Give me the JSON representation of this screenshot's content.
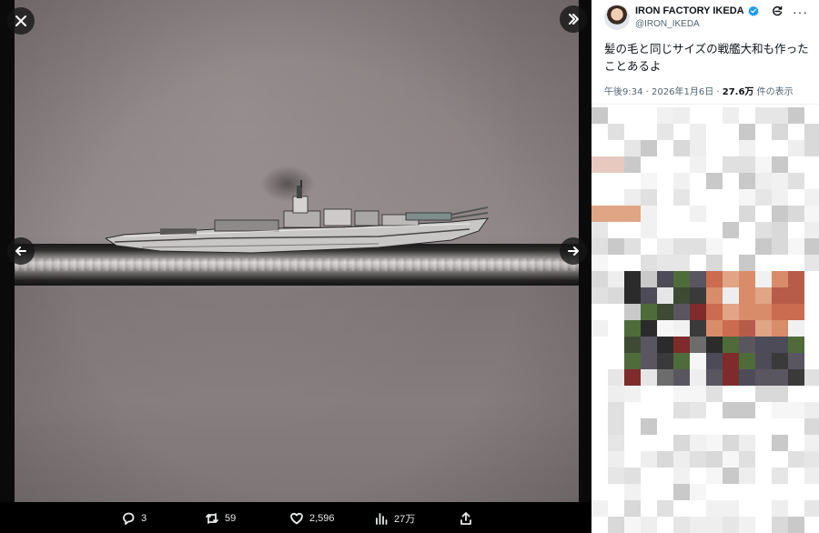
{
  "viewer": {
    "close_label": "close",
    "prev_label": "previous",
    "next_label": "next",
    "expand_label": "expand"
  },
  "actions": {
    "reply_count": "3",
    "retweet_count": "59",
    "like_count": "2,596",
    "view_count": "27万"
  },
  "tweet": {
    "display_name": "IRON FACTORY IKEDA",
    "handle": "@IRON_IKEDA",
    "text": "髪の毛と同じサイズの戦艦大和も作った\nことあるよ",
    "time": "午後9:34",
    "date": "2026年1月6日",
    "views_number": "27.6万",
    "views_suffix": "件の表示"
  },
  "colors": {
    "verified": "#1d9bf0",
    "panel_bg": "#ffffff",
    "viewer_bg": "#0a0a0a"
  },
  "icons": [
    "close-icon",
    "expand-icon",
    "arrow-left-icon",
    "arrow-right-icon",
    "reply-icon",
    "retweet-icon",
    "like-icon",
    "views-icon",
    "share-icon",
    "verified-icon",
    "grok-icon",
    "more-icon"
  ]
}
